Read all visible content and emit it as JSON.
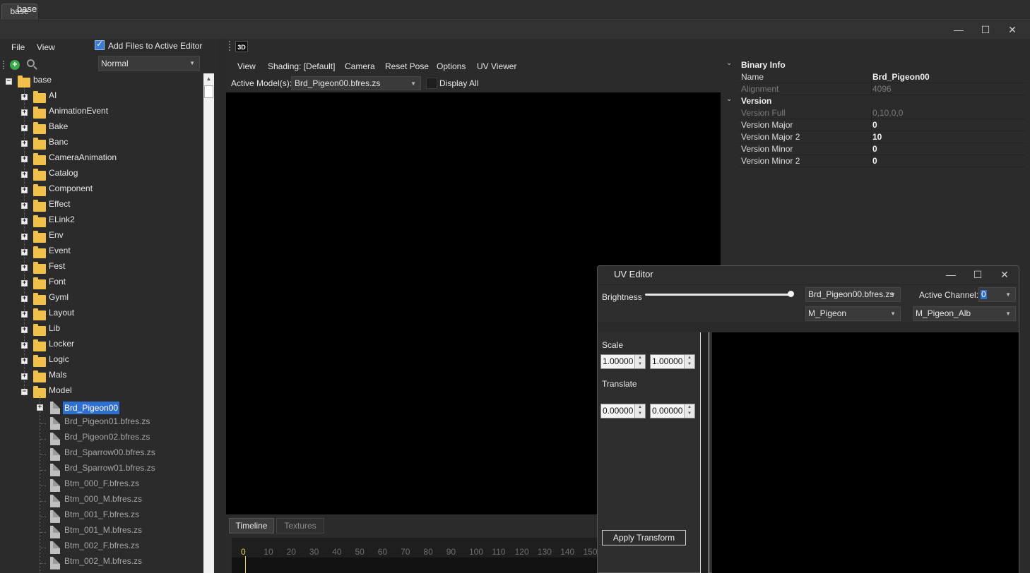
{
  "tabs": [
    "base"
  ],
  "window": {
    "title": "base"
  },
  "left": {
    "menu": [
      "File",
      "View"
    ],
    "add_files_label": "Add Files to Active Editor",
    "add_files_checked": true,
    "mode_select": "Normal",
    "tree": {
      "root": "base",
      "folders": [
        "AI",
        "AnimationEvent",
        "Bake",
        "Banc",
        "CameraAnimation",
        "Catalog",
        "Component",
        "Effect",
        "ELink2",
        "Env",
        "Event",
        "Fest",
        "Font",
        "Gyml",
        "Layout",
        "Lib",
        "Locker",
        "Logic",
        "Mals",
        "Model"
      ],
      "selected": "Brd_Pigeon00",
      "files": [
        "Brd_Pigeon01.bfres.zs",
        "Brd_Pigeon02.bfres.zs",
        "Brd_Sparrow00.bfres.zs",
        "Brd_Sparrow01.bfres.zs",
        "Btm_000_F.bfres.zs",
        "Btm_000_M.bfres.zs",
        "Btm_001_F.bfres.zs",
        "Btm_001_M.bfres.zs",
        "Btm_002_F.bfres.zs",
        "Btm_002_M.bfres.zs"
      ]
    }
  },
  "viewer": {
    "badge": "3D",
    "menu": [
      "View",
      "Shading: [Default]",
      "Camera",
      "Reset Pose",
      "Options",
      "UV Viewer"
    ],
    "active_model_label": "Active Model(s):",
    "active_model_value": "Brd_Pigeon00.bfres.zs",
    "display_all_label": "Display All",
    "display_all_checked": false
  },
  "timeline": {
    "tabs": [
      "Timeline",
      "Textures"
    ],
    "ticks": [
      "0",
      "10",
      "20",
      "30",
      "40",
      "50",
      "60",
      "70",
      "80",
      "90",
      "100",
      "110",
      "120",
      "130",
      "140",
      "150"
    ],
    "current_frame": 0
  },
  "properties": {
    "binary_info": {
      "title": "Binary Info",
      "rows": [
        {
          "name": "Name",
          "value": "Brd_Pigeon00",
          "readonly": false
        },
        {
          "name": "Alignment",
          "value": "4096",
          "readonly": true
        }
      ]
    },
    "version": {
      "title": "Version",
      "rows": [
        {
          "name": "Version Full",
          "value": "0,10,0,0",
          "readonly": true
        },
        {
          "name": "Version Major",
          "value": "0",
          "readonly": false
        },
        {
          "name": "Version Major 2",
          "value": "10",
          "readonly": false
        },
        {
          "name": "Version Minor",
          "value": "0",
          "readonly": false
        },
        {
          "name": "Version Minor 2",
          "value": "0",
          "readonly": false
        }
      ]
    }
  },
  "uv_editor": {
    "title": "UV Editor",
    "brightness_label": "Brightness",
    "brightness_level": 1.0,
    "model_select": "Brd_Pigeon00.bfres.zs",
    "material_select": "M_Pigeon",
    "texture_select": "M_Pigeon_Alb",
    "active_channel_label": "Active Channel:",
    "active_channel_value": "0",
    "scale_label": "Scale",
    "scale_x": "1.00000",
    "scale_y": "1.00000",
    "translate_label": "Translate",
    "translate_x": "0.00000",
    "translate_y": "0.00000",
    "apply_label": "Apply Transform"
  },
  "colors": {
    "selection": "#2f6fd0",
    "folder": "#f0c04a",
    "playhead": "#e8d44d"
  }
}
